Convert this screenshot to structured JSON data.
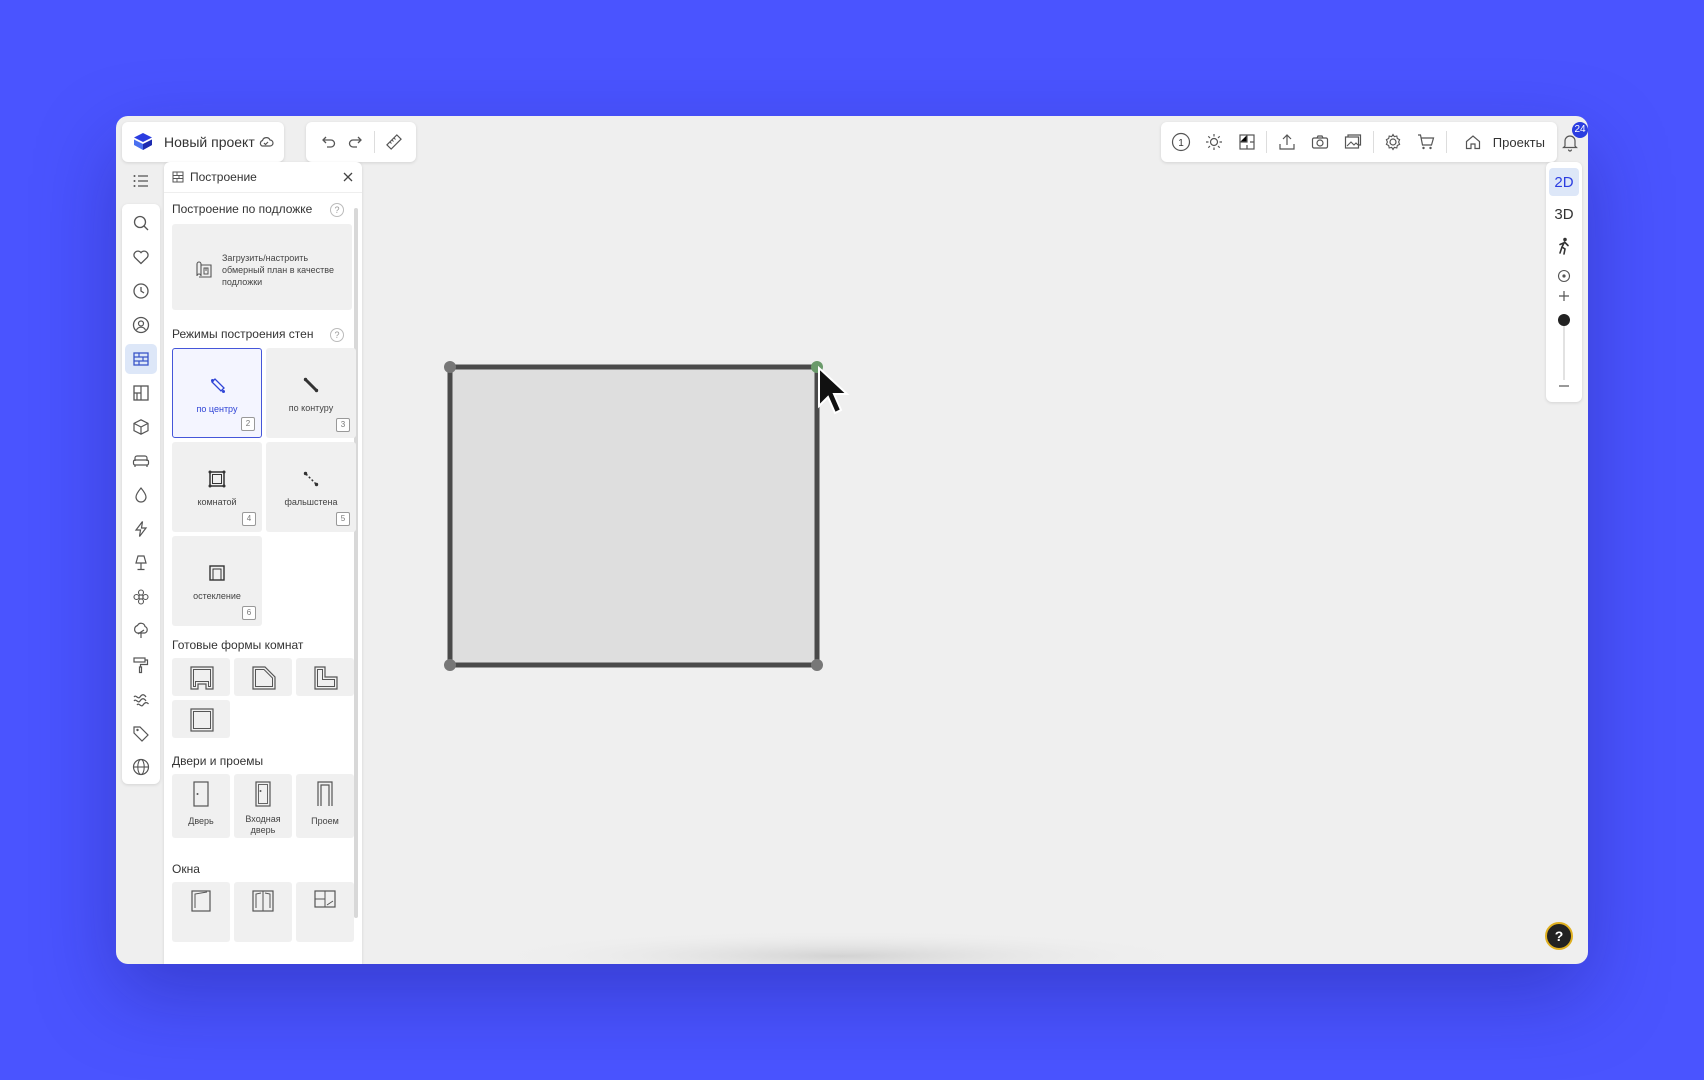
{
  "project": {
    "title": "Новый проект"
  },
  "header": {
    "projects_label": "Проекты",
    "notifications_count": "24"
  },
  "panel": {
    "title": "Построение",
    "underlay_section": "Построение по подложке",
    "underlay_button": "Загрузить/настроить обмерный план в качестве подложки",
    "modes_section": "Режимы построения стен",
    "modes": [
      {
        "label": "по центру",
        "key": "2"
      },
      {
        "label": "по контуру",
        "key": "3"
      },
      {
        "label": "комнатой",
        "key": "4"
      },
      {
        "label": "фальшстена",
        "key": "5"
      },
      {
        "label": "остекление",
        "key": "6"
      }
    ],
    "shapes_section": "Готовые формы комнат",
    "doors_section": "Двери и проемы",
    "doors": [
      {
        "label": "Дверь"
      },
      {
        "label": "Входная дверь"
      },
      {
        "label": "Проем"
      }
    ],
    "windows_section": "Окна"
  },
  "view": {
    "mode_2d": "2D",
    "mode_3d": "3D"
  },
  "help": {
    "symbol": "?"
  },
  "colors": {
    "accent": "#2b3de0",
    "background": "#4a54ff",
    "wall": "#4a4a4a",
    "room_fill": "#dedede"
  }
}
